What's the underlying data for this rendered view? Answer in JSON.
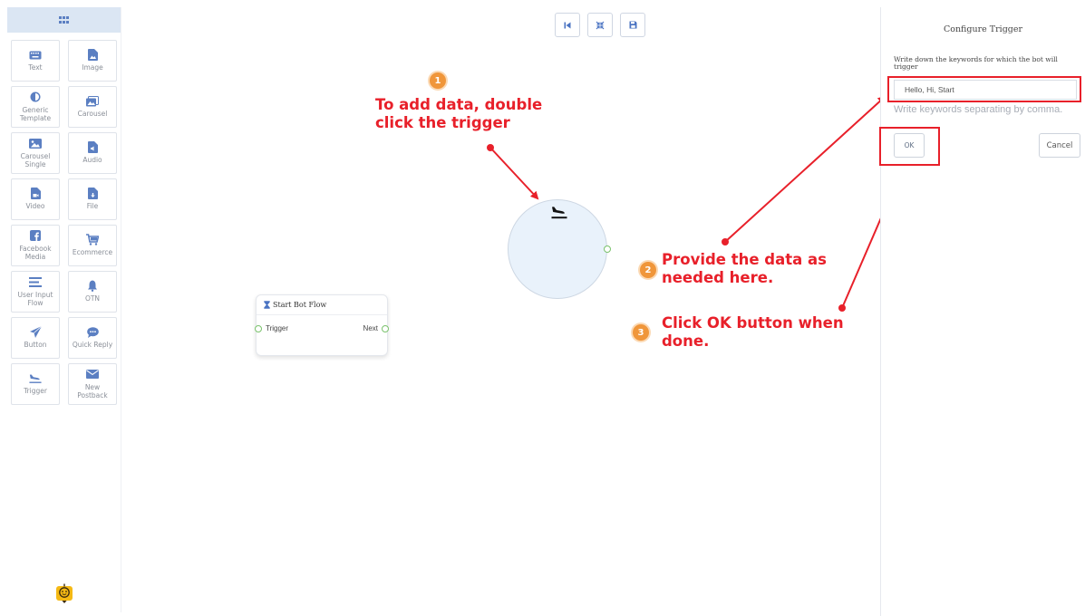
{
  "sidebar": {
    "tools": [
      {
        "label": "Text",
        "icon": "keyboard-icon"
      },
      {
        "label": "Image",
        "icon": "image-file-icon"
      },
      {
        "label": "Generic Template",
        "icon": "half-circle-icon"
      },
      {
        "label": "Carousel",
        "icon": "images-icon"
      },
      {
        "label": "Carousel Single",
        "icon": "image-icon"
      },
      {
        "label": "Audio",
        "icon": "audio-file-icon"
      },
      {
        "label": "Video",
        "icon": "video-file-icon"
      },
      {
        "label": "File",
        "icon": "download-file-icon"
      },
      {
        "label": "Facebook Media",
        "icon": "facebook-icon"
      },
      {
        "label": "Ecommerce",
        "icon": "cart-icon"
      },
      {
        "label": "User Input Flow",
        "icon": "list-icon"
      },
      {
        "label": "OTN",
        "icon": "bell-icon"
      },
      {
        "label": "Button",
        "icon": "send-icon"
      },
      {
        "label": "Quick Reply",
        "icon": "chat-icon"
      },
      {
        "label": "Trigger",
        "icon": "plane-landing-icon"
      },
      {
        "label": "New Postback",
        "icon": "envelope-icon"
      }
    ],
    "accent": "#5b7fc2"
  },
  "canvas": {
    "start_node": {
      "title": "Start Bot Flow",
      "left_port": "Trigger",
      "right_port": "Next"
    }
  },
  "annotations": {
    "step1": {
      "badge": "1",
      "lines": [
        "To add data, double",
        "click the trigger"
      ]
    },
    "step2": {
      "badge": "2",
      "lines": [
        "Provide the data as",
        "needed here."
      ]
    },
    "step3": {
      "badge": "3",
      "lines": [
        "Click OK button when",
        "done."
      ]
    },
    "color": "#e8202a"
  },
  "panel": {
    "title": "Configure Trigger",
    "label": "Write down the keywords for which the bot will trigger",
    "keywords_value": "Hello, Hi, Start",
    "hint": "Write keywords separating by comma.",
    "ok_label": "OK",
    "cancel_label": "Cancel"
  }
}
